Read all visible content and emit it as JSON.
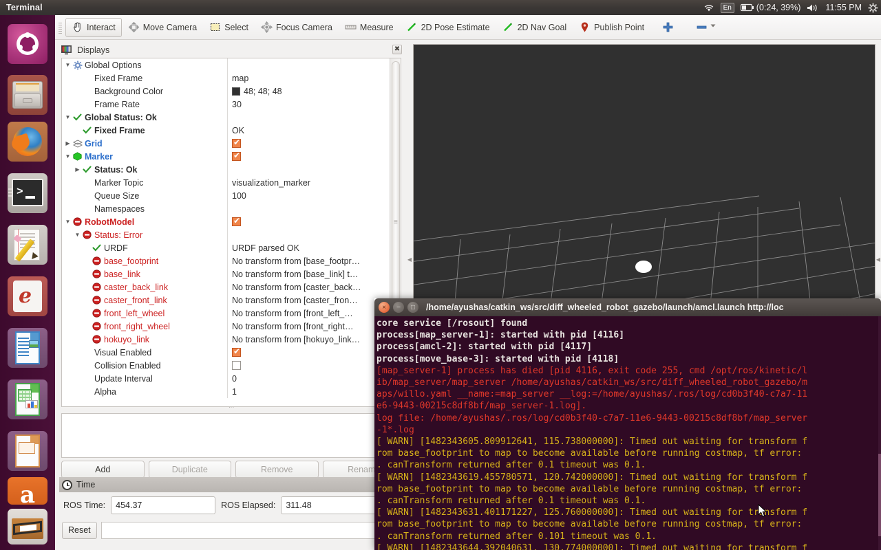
{
  "top_panel": {
    "app_title": "Terminal",
    "indicators": {
      "wifi": "wifi-icon",
      "keyboard_layout": "En",
      "battery": "(0:24, 39%)",
      "volume": "volume-icon",
      "clock": "11:55 PM",
      "settings": "gear-icon"
    }
  },
  "launcher": {
    "items": [
      {
        "name": "ubuntu-dash",
        "label": "Ubuntu Dash"
      },
      {
        "name": "files",
        "label": "Files"
      },
      {
        "name": "firefox",
        "label": "Firefox Web Browser"
      },
      {
        "name": "terminal",
        "label": "Terminal"
      },
      {
        "name": "text-editor",
        "label": "Text Editor"
      },
      {
        "name": "software-center",
        "label": "Ubuntu Software Center"
      },
      {
        "name": "libreoffice-writer",
        "label": "LibreOffice Writer"
      },
      {
        "name": "libreoffice-calc",
        "label": "LibreOffice Calc"
      },
      {
        "name": "libreoffice-impress",
        "label": "LibreOffice Impress"
      },
      {
        "name": "amazon",
        "label": "Amazon"
      },
      {
        "name": "ubuntu-software",
        "label": "Ubuntu Software"
      }
    ]
  },
  "rviz": {
    "toolbar": [
      {
        "label": "Interact",
        "icon": "hand-cursor-icon",
        "active": true
      },
      {
        "label": "Move Camera",
        "icon": "move-camera-icon",
        "active": false
      },
      {
        "label": "Select",
        "icon": "select-rect-icon",
        "active": false
      },
      {
        "label": "Focus Camera",
        "icon": "focus-camera-icon",
        "active": false
      },
      {
        "label": "Measure",
        "icon": "ruler-icon",
        "active": false
      },
      {
        "label": "2D Pose Estimate",
        "icon": "pose-arrow-icon",
        "active": false
      },
      {
        "label": "2D Nav Goal",
        "icon": "nav-goal-arrow-icon",
        "active": false
      },
      {
        "label": "Publish Point",
        "icon": "map-pin-icon",
        "active": false
      }
    ],
    "toolbar_extra": [
      {
        "name": "add-tool-button",
        "icon": "plus-icon"
      },
      {
        "name": "remove-tool-button",
        "icon": "minus-icon"
      },
      {
        "name": "tool-overflow-button",
        "icon": "chevron-down-icon"
      }
    ],
    "displays_panel": {
      "title": "Displays",
      "close": "✖",
      "tree": [
        {
          "indent": 0,
          "expander": "▼",
          "icon": "gear-icon",
          "label": "Global Options",
          "style": "normal",
          "value": "",
          "value_type": "text"
        },
        {
          "indent": 1,
          "expander": "",
          "icon": "",
          "label": "Fixed Frame",
          "style": "normal",
          "value": "map",
          "value_type": "text"
        },
        {
          "indent": 1,
          "expander": "",
          "icon": "",
          "label": "Background Color",
          "style": "normal",
          "value": "48; 48; 48",
          "value_type": "color",
          "swatch": "#303030"
        },
        {
          "indent": 1,
          "expander": "",
          "icon": "",
          "label": "Frame Rate",
          "style": "normal",
          "value": "30",
          "value_type": "text"
        },
        {
          "indent": 0,
          "expander": "▼",
          "icon": "check-icon",
          "label": "Global Status: Ok",
          "style": "bold",
          "value": "",
          "value_type": "text"
        },
        {
          "indent": 1,
          "expander": "",
          "icon": "check-icon",
          "label": "Fixed Frame",
          "style": "bold",
          "value": "OK",
          "value_type": "text"
        },
        {
          "indent": 0,
          "expander": "▶",
          "icon": "grid-icon",
          "label": "Grid",
          "style": "bluebold",
          "value": "",
          "value_type": "checkbox",
          "checked": true
        },
        {
          "indent": 0,
          "expander": "▼",
          "icon": "green-cube-icon",
          "label": "Marker",
          "style": "bluebold",
          "value": "",
          "value_type": "checkbox",
          "checked": true
        },
        {
          "indent": 1,
          "expander": "▶",
          "icon": "check-icon",
          "label": "Status: Ok",
          "style": "bold",
          "value": "",
          "value_type": "text"
        },
        {
          "indent": 1,
          "expander": "",
          "icon": "",
          "label": "Marker Topic",
          "style": "normal",
          "value": "visualization_marker",
          "value_type": "text"
        },
        {
          "indent": 1,
          "expander": "",
          "icon": "",
          "label": "Queue Size",
          "style": "normal",
          "value": "100",
          "value_type": "text"
        },
        {
          "indent": 1,
          "expander": "",
          "icon": "",
          "label": "Namespaces",
          "style": "normal",
          "value": "",
          "value_type": "text"
        },
        {
          "indent": 0,
          "expander": "▼",
          "icon": "error-icon",
          "label": "RobotModel",
          "style": "redbold",
          "value": "",
          "value_type": "checkbox",
          "checked": true
        },
        {
          "indent": 1,
          "expander": "▼",
          "icon": "error-icon",
          "label": "Status: Error",
          "style": "red",
          "value": "",
          "value_type": "text"
        },
        {
          "indent": 2,
          "expander": "",
          "icon": "check-icon",
          "label": "URDF",
          "style": "normal",
          "value": "URDF parsed OK",
          "value_type": "text"
        },
        {
          "indent": 2,
          "expander": "",
          "icon": "error-icon",
          "label": "base_footprint",
          "style": "red",
          "value": "No transform from [base_footpr…",
          "value_type": "text"
        },
        {
          "indent": 2,
          "expander": "",
          "icon": "error-icon",
          "label": "base_link",
          "style": "red",
          "value": "No transform from [base_link] t…",
          "value_type": "text"
        },
        {
          "indent": 2,
          "expander": "",
          "icon": "error-icon",
          "label": "caster_back_link",
          "style": "red",
          "value": "No transform from [caster_back…",
          "value_type": "text"
        },
        {
          "indent": 2,
          "expander": "",
          "icon": "error-icon",
          "label": "caster_front_link",
          "style": "red",
          "value": "No transform from [caster_fron…",
          "value_type": "text"
        },
        {
          "indent": 2,
          "expander": "",
          "icon": "error-icon",
          "label": "front_left_wheel",
          "style": "red",
          "value": "No transform from [front_left_…",
          "value_type": "text"
        },
        {
          "indent": 2,
          "expander": "",
          "icon": "error-icon",
          "label": "front_right_wheel",
          "style": "red",
          "value": "No transform from [front_right…",
          "value_type": "text"
        },
        {
          "indent": 2,
          "expander": "",
          "icon": "error-icon",
          "label": "hokuyo_link",
          "style": "red",
          "value": "No transform from [hokuyo_link…",
          "value_type": "text"
        },
        {
          "indent": 1,
          "expander": "",
          "icon": "",
          "label": "Visual Enabled",
          "style": "normal",
          "value": "",
          "value_type": "checkbox",
          "checked": true
        },
        {
          "indent": 1,
          "expander": "",
          "icon": "",
          "label": "Collision Enabled",
          "style": "normal",
          "value": "",
          "value_type": "checkbox",
          "checked": false
        },
        {
          "indent": 1,
          "expander": "",
          "icon": "",
          "label": "Update Interval",
          "style": "normal",
          "value": "0",
          "value_type": "text"
        },
        {
          "indent": 1,
          "expander": "",
          "icon": "",
          "label": "Alpha",
          "style": "normal",
          "value": "1",
          "value_type": "text"
        }
      ],
      "buttons": [
        {
          "label": "Add",
          "enabled": true
        },
        {
          "label": "Duplicate",
          "enabled": false
        },
        {
          "label": "Remove",
          "enabled": false
        },
        {
          "label": "Rename",
          "enabled": false
        }
      ]
    },
    "time_panel": {
      "title": "Time",
      "ros_time_label": "ROS Time:",
      "ros_time_value": "454.37",
      "ros_elapsed_label": "ROS Elapsed:",
      "ros_elapsed_value": "311.48",
      "reset_label": "Reset"
    },
    "view3d": {
      "background_color": "#303030",
      "grid_color": "#9b9b9b",
      "marker_color": "#000000",
      "robot_dot_color": "#ffffff"
    }
  },
  "terminal": {
    "title": "/home/ayushas/catkin_ws/src/diff_wheeled_robot_gazebo/launch/amcl.launch http://loc",
    "window_buttons": {
      "close": "×",
      "minimize": "−",
      "maximize": "□"
    },
    "lines": [
      {
        "text": "core service [/rosout] found",
        "color": "white"
      },
      {
        "text": "process[map_server-1]: started with pid [4116]",
        "color": "white"
      },
      {
        "text": "process[amcl-2]: started with pid [4117]",
        "color": "white"
      },
      {
        "text": "process[move_base-3]: started with pid [4118]",
        "color": "white"
      },
      {
        "text": "[map_server-1] process has died [pid 4116, exit code 255, cmd /opt/ros/kinetic/l",
        "color": "red"
      },
      {
        "text": "ib/map_server/map_server /home/ayushas/catkin_ws/src/diff_wheeled_robot_gazebo/m",
        "color": "red"
      },
      {
        "text": "aps/willo.yaml __name:=map_server __log:=/home/ayushas/.ros/log/cd0b3f40-c7a7-11",
        "color": "red"
      },
      {
        "text": "e6-9443-00215c8df8bf/map_server-1.log].",
        "color": "red"
      },
      {
        "text": "log file: /home/ayushas/.ros/log/cd0b3f40-c7a7-11e6-9443-00215c8df8bf/map_server",
        "color": "red"
      },
      {
        "text": "-1*.log",
        "color": "red"
      },
      {
        "text": "[ WARN] [1482343605.809912641, 115.738000000]: Timed out waiting for transform f",
        "color": "yellow"
      },
      {
        "text": "rom base_footprint to map to become available before running costmap, tf error:",
        "color": "yellow"
      },
      {
        "text": ". canTransform returned after 0.1 timeout was 0.1.",
        "color": "yellow"
      },
      {
        "text": "[ WARN] [1482343619.455780571, 120.742000000]: Timed out waiting for transform f",
        "color": "yellow"
      },
      {
        "text": "rom base_footprint to map to become available before running costmap, tf error:",
        "color": "yellow"
      },
      {
        "text": ". canTransform returned after 0.1 timeout was 0.1.",
        "color": "yellow"
      },
      {
        "text": "[ WARN] [1482343631.401171227, 125.760000000]: Timed out waiting for transform f",
        "color": "yellow"
      },
      {
        "text": "rom base_footprint to map to become available before running costmap, tf error:",
        "color": "yellow"
      },
      {
        "text": ". canTransform returned after 0.101 timeout was 0.1.",
        "color": "yellow"
      },
      {
        "text": "[ WARN] [1482343644.392040631, 130.774000000]: Timed out waiting for transform f",
        "color": "yellow"
      }
    ]
  }
}
